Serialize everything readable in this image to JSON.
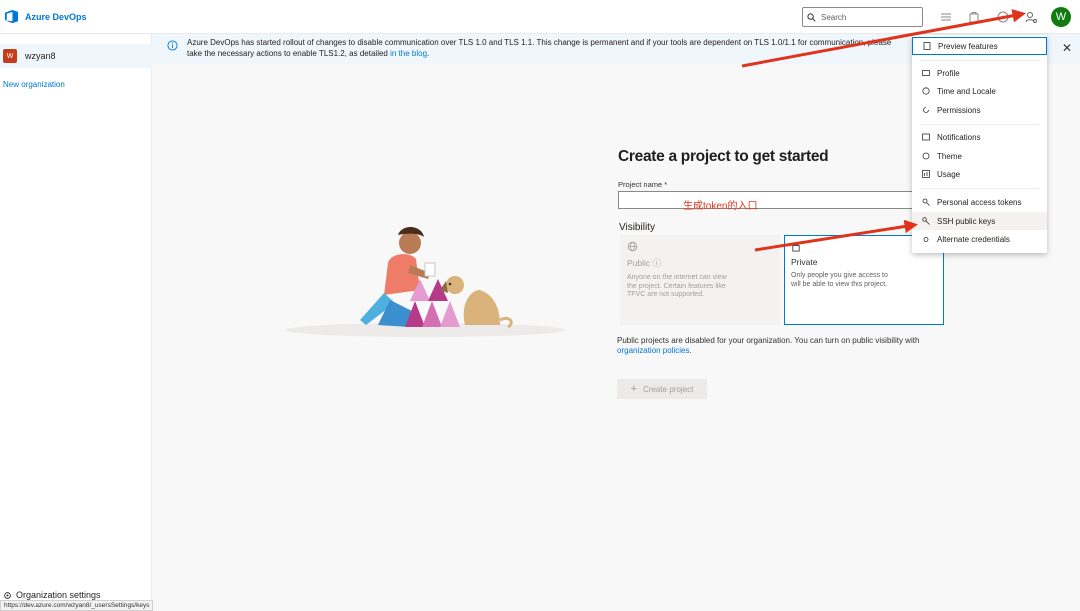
{
  "app": {
    "name": "Azure DevOps"
  },
  "header": {
    "search_placeholder": "Search",
    "avatar_initial": "W"
  },
  "sidebar": {
    "org": {
      "badge": "W",
      "name": "wzyan8"
    },
    "new_org_label": "New organization",
    "settings_label": "Organization settings"
  },
  "banner": {
    "text": "Azure DevOps has started rollout of changes to disable communication over TLS 1.0 and TLS 1.1. This change is permanent and if your tools are dependent on TLS 1.0/1.1 for communication, please take the necessary actions to enable TLS1.2, as detailed ",
    "link_text": "in the blog",
    "text_end": "."
  },
  "main": {
    "title": "Create a project to get started",
    "project_name_label": "Project name *",
    "visibility_label": "Visibility",
    "public": {
      "title": "Public ⓘ",
      "desc": "Anyone on the internet can view the project. Certain features like TFVC are not supported."
    },
    "private": {
      "title": "Private",
      "desc": "Only people you give access to will be able to view this project."
    },
    "disabled_note": "Public projects are disabled for your organization. You can turn on public visibility with ",
    "disabled_link": "organization policies",
    "disabled_end": ".",
    "create_button": "Create project"
  },
  "annotation": "生成token的入口",
  "menu": {
    "items": [
      {
        "label": "Preview features",
        "icon": "preview-icon"
      },
      {
        "label": "Profile",
        "icon": "profile-icon"
      },
      {
        "label": "Time and Locale",
        "icon": "globe-icon"
      },
      {
        "label": "Permissions",
        "icon": "permissions-icon"
      },
      {
        "label": "Notifications",
        "icon": "notifications-icon"
      },
      {
        "label": "Theme",
        "icon": "theme-icon"
      },
      {
        "label": "Usage",
        "icon": "usage-icon"
      },
      {
        "label": "Personal access tokens",
        "icon": "token-icon"
      },
      {
        "label": "SSH public keys",
        "icon": "key-icon"
      },
      {
        "label": "Alternate credentials",
        "icon": "credentials-icon"
      }
    ]
  },
  "status_url": "https://dev.azure.com/wzyan8/_usersSettings/keys",
  "colors": {
    "accent": "#0078d4",
    "avatar": "#107c10",
    "org_badge": "#c43e1c",
    "arrow": "#e0331c"
  }
}
